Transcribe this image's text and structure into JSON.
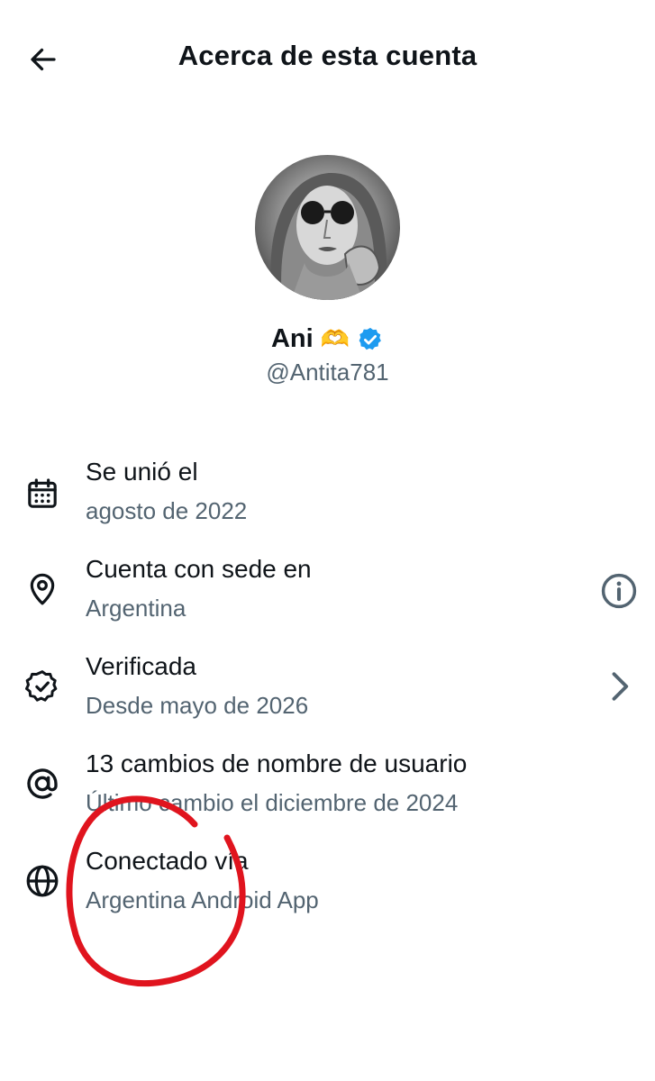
{
  "header": {
    "title": "Acerca de esta cuenta",
    "back_icon": "arrow-left-icon"
  },
  "profile": {
    "display_name": "Ani",
    "emoji": "🫶",
    "handle": "@Antita781",
    "verified_badge_color": "#1d9bf0",
    "avatar_icon": "profile-photo"
  },
  "details": [
    {
      "icon": "calendar-icon",
      "title": "Se unió el",
      "subtitle": "agosto de 2022"
    },
    {
      "icon": "location-pin-icon",
      "title": "Cuenta con sede en",
      "subtitle": "Argentina",
      "action_icon": "info-icon"
    },
    {
      "icon": "verified-badge-icon",
      "title": "Verificada",
      "subtitle": "Desde mayo de 2026",
      "action_icon": "chevron-right-icon"
    },
    {
      "icon": "at-sign-icon",
      "title": "13 cambios de nombre de usuario",
      "subtitle": "Último cambio el diciembre de 2024"
    },
    {
      "icon": "globe-icon",
      "title": "Conectado vía",
      "subtitle": "Argentina Android App"
    }
  ],
  "colors": {
    "text_primary": "#0f1419",
    "text_secondary": "#536471",
    "annotation_red": "#e0141e"
  }
}
